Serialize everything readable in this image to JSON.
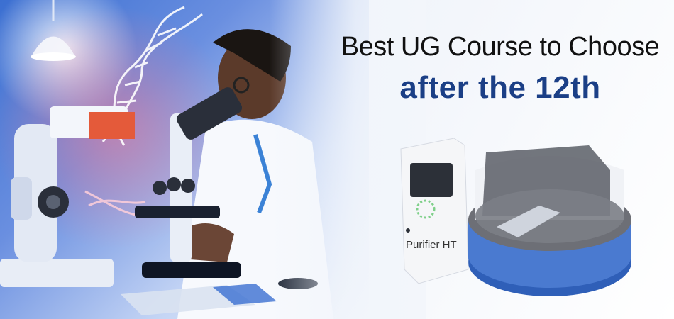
{
  "headline": {
    "line1": "Best UG Course to Choose",
    "line2": "after the 12th"
  },
  "device": {
    "label": "Purifier HT"
  },
  "colors": {
    "headline_primary": "#111111",
    "headline_accent": "#1b3f86",
    "photo_blue": "#3b6fd1",
    "device_blue": "#2f5fb8"
  },
  "icons": {
    "microscope": "microscope-icon",
    "dna": "dna-helix-icon",
    "scientist": "scientist-illustration",
    "lamp": "ceiling-lamp-icon",
    "device": "purifier-device-illustration"
  }
}
